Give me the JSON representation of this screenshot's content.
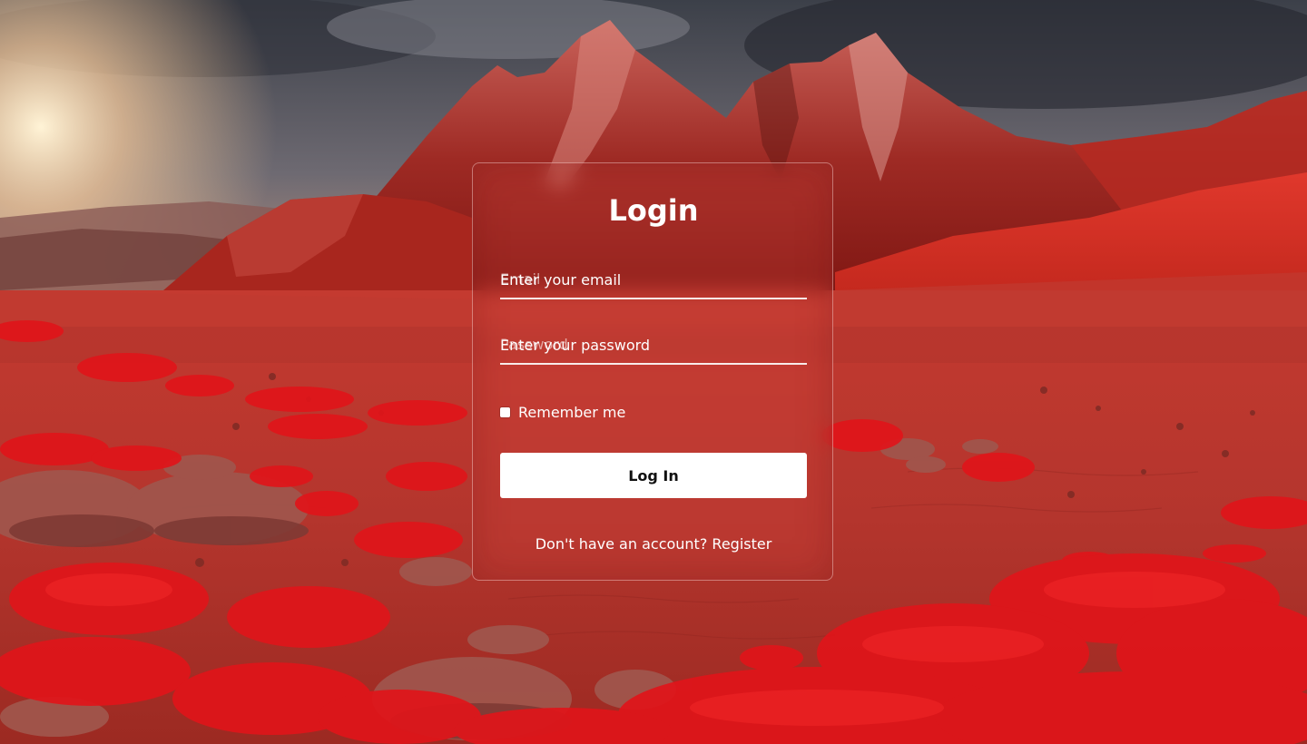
{
  "login_form": {
    "title": "Login",
    "email_field": {
      "placeholder": "Enter your email",
      "floating_label": "Email",
      "value": ""
    },
    "password_field": {
      "placeholder": "Enter your password",
      "floating_label": "Password",
      "value": ""
    },
    "remember_me": {
      "label": "Remember me",
      "checked": false
    },
    "submit_label": "Log In",
    "register_prompt": "Don't have an account?",
    "register_link_label": "Register"
  },
  "colors": {
    "card_tint": "#d2463c",
    "button_bg": "#ffffff",
    "text": "#ffffff"
  },
  "icons": {
    "background": "red-desert-mountains-landscape"
  }
}
